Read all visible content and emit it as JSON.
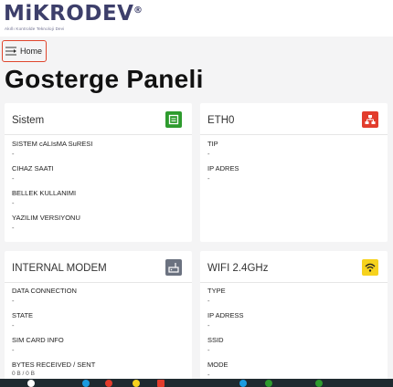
{
  "header": {
    "logo": "MiKRODEV",
    "registered": "®",
    "tagline": "Akıllı Kontrolde Teknoloji Devi",
    "home_label": "Home"
  },
  "page": {
    "title": "Gosterge Paneli"
  },
  "cards": {
    "sistem": {
      "title": "Sistem",
      "fields": [
        {
          "label": "SISTEM cALIsMA SuRESI",
          "value": "-"
        },
        {
          "label": "CIHAZ SAATI",
          "value": "-"
        },
        {
          "label": "BELLEK KULLANIMI",
          "value": "-"
        },
        {
          "label": "YAZILIM VERSIYONU",
          "value": "-"
        }
      ]
    },
    "eth0": {
      "title": "ETH0",
      "fields": [
        {
          "label": "TIP",
          "value": "-"
        },
        {
          "label": "IP ADRES",
          "value": "-"
        }
      ]
    },
    "modem": {
      "title": "INTERNAL MODEM",
      "fields": [
        {
          "label": "DATA CONNECTION",
          "value": "-"
        },
        {
          "label": "STATE",
          "value": "-"
        },
        {
          "label": "SIM CARD INFO",
          "value": "-"
        },
        {
          "label": "BYTES RECEIVED / SENT",
          "value": "0 B / 0 B"
        }
      ]
    },
    "wifi": {
      "title": "WIFI 2.4GHz",
      "fields": [
        {
          "label": "TYPE",
          "value": "-"
        },
        {
          "label": "IP ADRESS",
          "value": "-"
        },
        {
          "label": "SSID",
          "value": "-"
        },
        {
          "label": "MODE",
          "value": "-"
        }
      ]
    }
  },
  "colors": {
    "sistem_icon": "#2e9b2e",
    "eth0_icon": "#e23c2c",
    "modem_icon": "#6b7280",
    "wifi_icon": "#f6d21d",
    "home_border": "#e0452c"
  },
  "icons": {
    "home": "menu-lines-icon",
    "sistem": "panel-icon",
    "eth0": "network-icon",
    "modem": "modem-icon",
    "wifi": "wifi-icon"
  }
}
